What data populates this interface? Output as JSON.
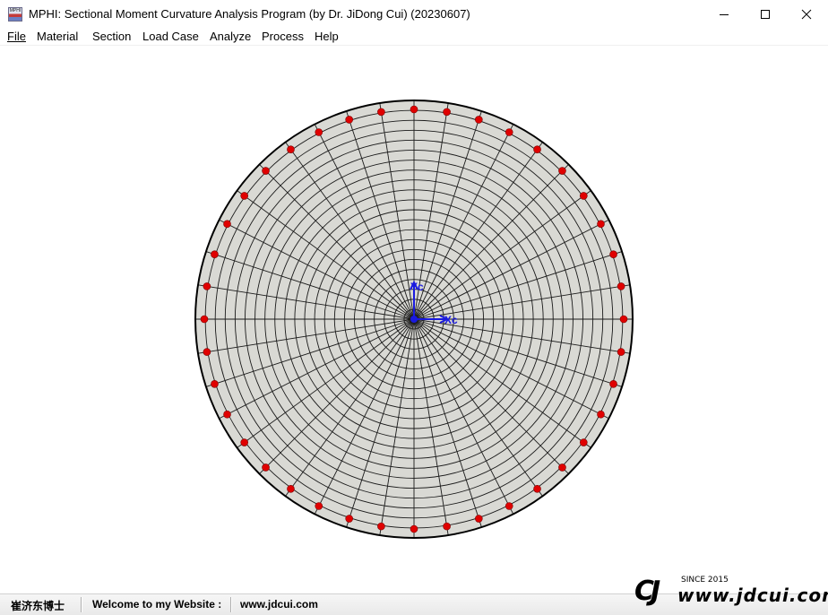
{
  "window": {
    "title": "MPHI: Sectional Moment Curvature Analysis Program (by Dr. JiDong Cui) (20230607)",
    "icon_text": "MPHI",
    "controls": [
      "minimize-icon",
      "maximize-icon",
      "close-icon"
    ]
  },
  "menu": {
    "items": [
      {
        "label": "File"
      },
      {
        "label": "Material"
      },
      {
        "label": "Section"
      },
      {
        "label": "Load Case"
      },
      {
        "label": "Analyze"
      },
      {
        "label": "Process"
      },
      {
        "label": "Help"
      }
    ]
  },
  "section_view": {
    "shape": "circle",
    "fill_color": "#d9d9d4",
    "outline_color": "#000000",
    "mesh_color": "#1a1a1a",
    "rebar_color": "#e00000",
    "radial_divisions": 40,
    "ring_divisions": 22,
    "rebar_count": 40,
    "axis_color": "#1a1adf",
    "axis_labels": {
      "y": "Yc",
      "x": "Xc"
    }
  },
  "statusbar": {
    "author": "崔济东博士",
    "welcome": "Welcome to my Website :",
    "website": "www.jdcui.com"
  },
  "logo": {
    "mark": "CJ",
    "since": "SINCE 2015",
    "url": "www.jdcui.com"
  }
}
